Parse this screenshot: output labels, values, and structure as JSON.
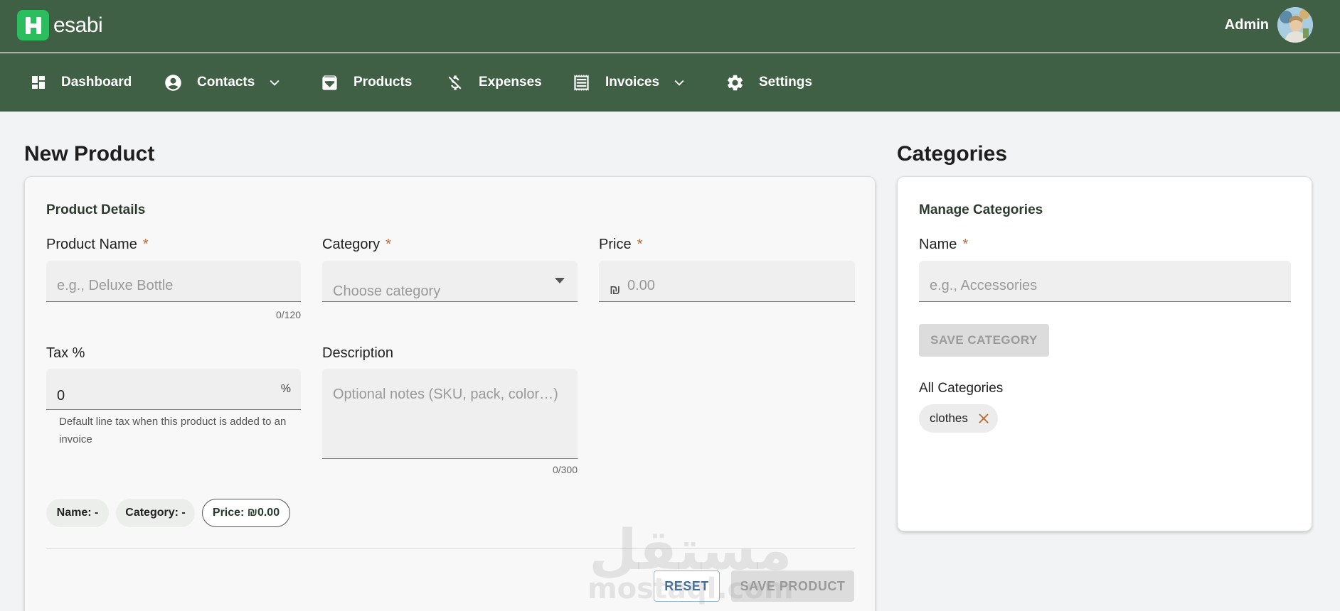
{
  "app": {
    "logo_letter": "H",
    "logo_text": "esabi"
  },
  "user": {
    "name": "Admin"
  },
  "nav": {
    "items": [
      {
        "label": "Dashboard",
        "icon": "dashboard-icon"
      },
      {
        "label": "Contacts",
        "icon": "account-circle-icon",
        "dropdown": true
      },
      {
        "label": "Products",
        "icon": "archive-box-icon"
      },
      {
        "label": "Expenses",
        "icon": "money-off-icon"
      },
      {
        "label": "Invoices",
        "icon": "receipt-icon",
        "dropdown": true
      },
      {
        "label": "Settings",
        "icon": "gear-icon"
      }
    ]
  },
  "new_product": {
    "title": "New Product",
    "card_title": "Product Details",
    "product_name": {
      "label": "Product Name",
      "placeholder": "e.g., Deluxe Bottle",
      "value": "",
      "counter": "0/120"
    },
    "category": {
      "label": "Category",
      "placeholder": "Choose category"
    },
    "price": {
      "label": "Price",
      "currency_symbol": "₪",
      "placeholder": "0.00"
    },
    "tax": {
      "label": "Tax %",
      "value": "0",
      "suffix": "%",
      "hint": "Default line tax when this product is added to an invoice"
    },
    "description": {
      "label": "Description",
      "placeholder": "Optional notes (SKU, pack, color…)",
      "counter": "0/300"
    },
    "summary": {
      "name": "Name: -",
      "category": "Category: -",
      "price": "Price: ₪0.00"
    },
    "reset_label": "RESET",
    "save_label": "SAVE PRODUCT"
  },
  "categories": {
    "title": "Categories",
    "card_title": "Manage Categories",
    "name": {
      "label": "Name",
      "placeholder": "e.g., Accessories"
    },
    "save_label": "SAVE CATEGORY",
    "list_title": "All Categories",
    "items": [
      {
        "label": "clothes"
      }
    ]
  },
  "required_marker": "*",
  "watermark": {
    "arabic": "مستقل",
    "latin": "mostaql.com"
  },
  "colors": {
    "header_bg": "#3f6045",
    "logo_green": "#2bbd5e",
    "required": "#c0662e",
    "page_bg": "#f2f3f4"
  }
}
